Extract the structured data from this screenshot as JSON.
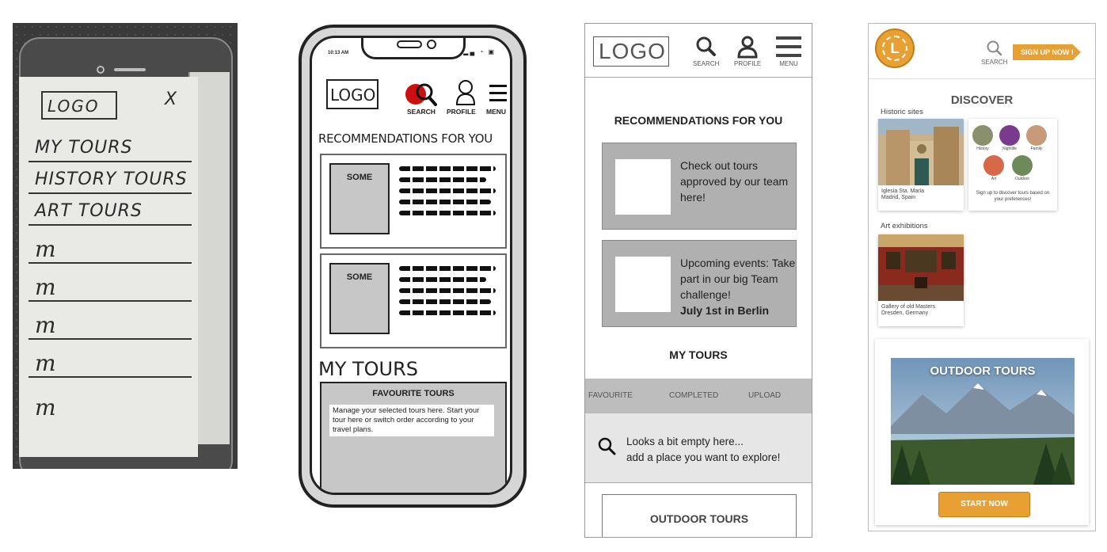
{
  "sketch": {
    "logo": "LOGO",
    "close": "X",
    "menu_items": [
      "MY TOURS",
      "HISTORY TOURS",
      "ART TOURS"
    ],
    "scribbles": [
      "m",
      "m",
      "m",
      "m",
      "m"
    ]
  },
  "lowfi": {
    "time": "10:13 AM",
    "logo": "LOGO",
    "search_label": "SEARCH",
    "profile_label": "PROFILE",
    "menu_label": "MENU",
    "recommendations_title": "RECOMMENDATIONS FOR YOU",
    "cards": [
      {
        "thumb": "SOME"
      },
      {
        "thumb": "SOME"
      }
    ],
    "my_tours_title": "MY TOURS",
    "favourite_title": "FAVOURITE TOURS",
    "favourite_desc": "Manage your selected tours here. Start your tour here or switch order according to your travel plans."
  },
  "wireframe": {
    "logo": "LOGO",
    "search_label": "SEARCH",
    "profile_label": "PROFILE",
    "menu_label": "MENU",
    "recommendations_title": "RECOMMENDATIONS FOR YOU",
    "card1_text": "Check out tours approved by our team here!",
    "card2_text": "Upcoming events: Take part in our big Team challenge!",
    "card2_bold": "July 1st in Berlin",
    "my_tours_title": "MY TOURS",
    "tabs": [
      "FAVOURITE",
      "COMPLETED",
      "UPLOAD"
    ],
    "empty_line1": "Looks a bit empty here...",
    "empty_line2": "add a place you want to explore!",
    "outdoor_title": "OUTDOOR TOURS"
  },
  "hifi": {
    "logo_letter": "L",
    "search_label": "SEARCH",
    "signup_label": "SIGN UP NOW !",
    "discover_title": "DISCOVER",
    "historic_label": "Historic sites",
    "historic_caption": "Iglesia Sta. Maria\nMadrid, Spain",
    "categories": [
      "History",
      "Nightlife",
      "Family",
      "Art",
      "Outdoor"
    ],
    "categories_caption": "Sign up to discover tours based on your preferences!",
    "art_label": "Art exhibitions",
    "art_caption": "Gallery of old Masters\nDresden, Germany",
    "outdoor_title": "OUTDOOR TOURS",
    "start_label": "START NOW",
    "colors": {
      "accent": "#e8a033"
    }
  }
}
